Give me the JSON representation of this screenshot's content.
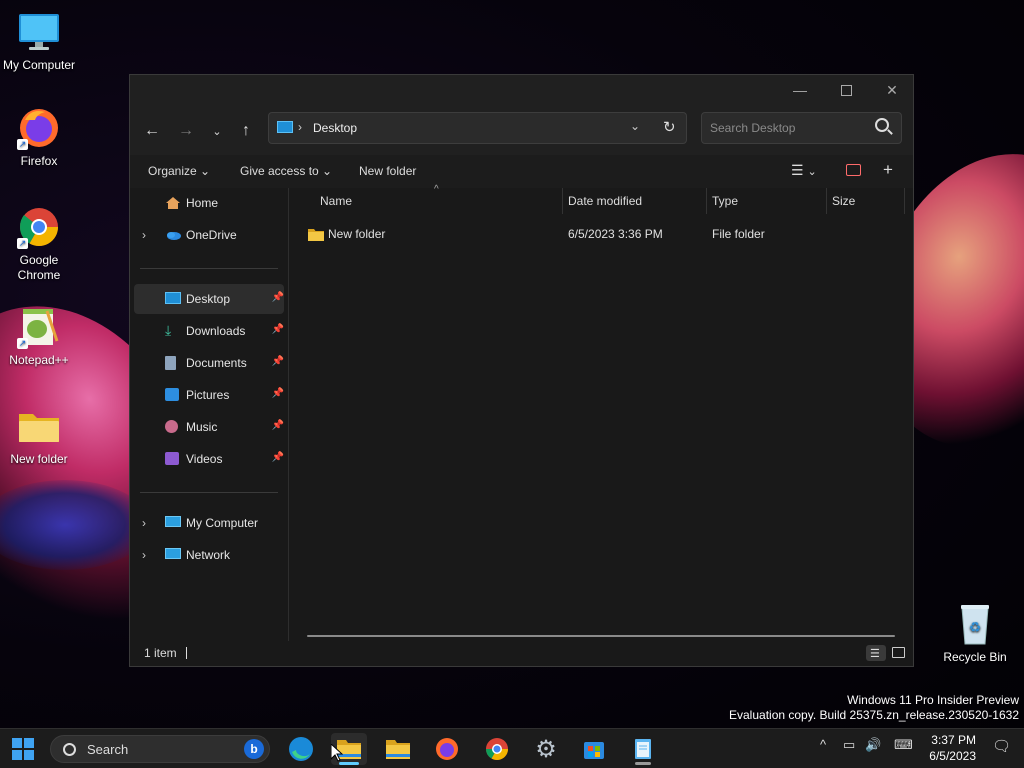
{
  "desktop": {
    "icons": [
      {
        "label": "My Computer"
      },
      {
        "label": "Firefox"
      },
      {
        "label": "Google Chrome"
      },
      {
        "label": "Notepad++"
      },
      {
        "label": "New folder"
      },
      {
        "label": "Recycle Bin"
      }
    ],
    "watermark": {
      "line1": "Windows 11 Pro Insider Preview",
      "line2": "Evaluation copy. Build 25375.zn_release.230520-1632"
    }
  },
  "explorer": {
    "address": {
      "location_icon": "desktop-icon",
      "path": "Desktop"
    },
    "search_placeholder": "Search Desktop",
    "commands": {
      "organize": "Organize",
      "give_access": "Give access to",
      "new_folder": "New folder"
    },
    "nav": {
      "home": "Home",
      "onedrive": "OneDrive",
      "quick_access": [
        {
          "label": "Desktop",
          "icon": "desktop-icon",
          "selected": true
        },
        {
          "label": "Downloads",
          "icon": "download-icon"
        },
        {
          "label": "Documents",
          "icon": "document-icon"
        },
        {
          "label": "Pictures",
          "icon": "picture-icon"
        },
        {
          "label": "Music",
          "icon": "music-icon"
        },
        {
          "label": "Videos",
          "icon": "video-icon"
        }
      ],
      "my_computer": "My Computer",
      "network": "Network"
    },
    "columns": {
      "name": "Name",
      "date_modified": "Date modified",
      "type": "Type",
      "size": "Size"
    },
    "files": [
      {
        "name": "New folder",
        "date_modified": "6/5/2023 3:36 PM",
        "type": "File folder",
        "size": ""
      }
    ],
    "status": {
      "item_count": "1 item"
    }
  },
  "taskbar": {
    "search_label": "Search",
    "apps": [
      "edge",
      "file-explorer",
      "file-explorer-2",
      "firefox",
      "chrome",
      "settings",
      "store",
      "notepad"
    ],
    "clock": {
      "time": "3:37 PM",
      "date": "6/5/2023"
    }
  },
  "colors": {
    "accent": "#60cdff",
    "window_bg": "#191919",
    "taskbar_bg": "#1c1c1c",
    "folder": "#f3c744"
  }
}
